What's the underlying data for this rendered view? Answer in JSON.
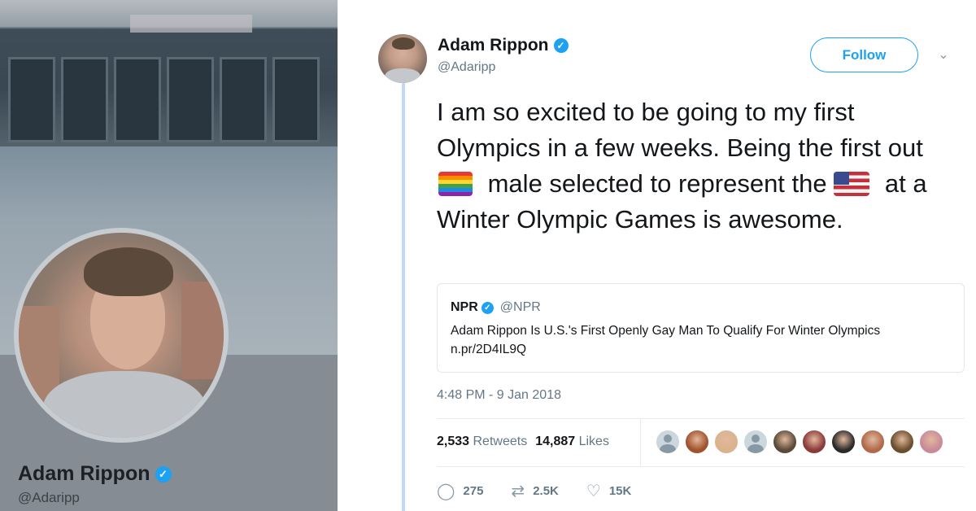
{
  "background_profile": {
    "name": "Adam Rippon",
    "handle": "@Adaripp"
  },
  "tweet": {
    "author_name": "Adam Rippon",
    "author_handle": "@Adaripp",
    "follow_label": "Follow",
    "text_parts": {
      "part1": "I am so excited to be going to my first Olympics in a few weeks. Being the first out",
      "part2": " male selected to represent the ",
      "part3": " at a Winter Olympic Games is awesome."
    },
    "quoted": {
      "name": "NPR",
      "handle": "@NPR",
      "text": "Adam Rippon Is U.S.'s First Openly Gay Man To Qualify For Winter Olympics n.pr/2D4IL9Q"
    },
    "timestamp": "4:48 PM - 9 Jan 2018",
    "stats": {
      "retweets_count": "2,533",
      "retweets_label": "Retweets",
      "likes_count": "14,887",
      "likes_label": "Likes"
    },
    "actions": {
      "replies": "275",
      "retweets": "2.5K",
      "likes": "15K"
    }
  },
  "likers": [
    {
      "type": "default"
    },
    {
      "type": "photo",
      "color": "#a0522d"
    },
    {
      "type": "photo",
      "color": "#d9b38c"
    },
    {
      "type": "default"
    },
    {
      "type": "photo",
      "color": "#5a4a3a"
    },
    {
      "type": "photo",
      "color": "#8b3a3a"
    },
    {
      "type": "photo",
      "color": "#2b2b2b"
    },
    {
      "type": "photo",
      "color": "#b06a4a"
    },
    {
      "type": "photo",
      "color": "#6b4e2e"
    },
    {
      "type": "photo",
      "color": "#c98a9a"
    }
  ],
  "colors": {
    "accent": "#1da1f2",
    "secondary_text": "#657786",
    "thread_line": "#c4d8f5"
  },
  "icons": [
    "verified-badge",
    "chevron-down-icon",
    "reply-icon",
    "retweet-icon",
    "like-icon",
    "rainbow-flag-emoji",
    "us-flag-emoji"
  ]
}
